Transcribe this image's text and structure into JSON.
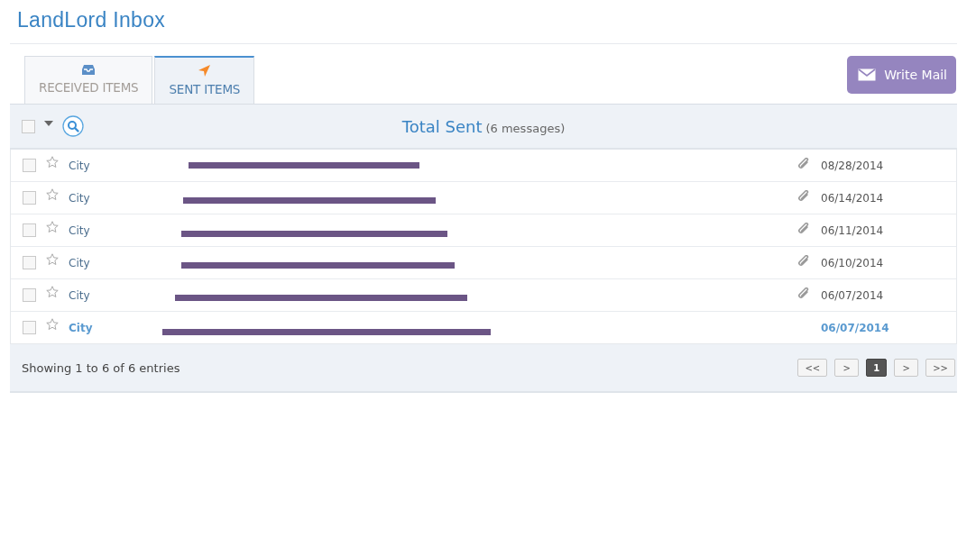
{
  "page": {
    "title": "LandLord Inbox"
  },
  "tabs": [
    {
      "label": "RECEIVED ITEMS",
      "kind": "inbox",
      "selected": false
    },
    {
      "label": "SENT ITEMS",
      "kind": "sent",
      "selected": true
    }
  ],
  "write_button": {
    "label": "Write Mail"
  },
  "toolbar": {
    "select_all": {
      "checked": false
    },
    "heading": "Total Sent",
    "count": "(6 messages)"
  },
  "messages": [
    {
      "sender": "City",
      "subject_redacted": true,
      "attachment": true,
      "date": "08/28/2014",
      "unread": false,
      "checked": false,
      "starred": false
    },
    {
      "sender": "City",
      "subject_redacted": true,
      "attachment": true,
      "date": "06/14/2014",
      "unread": false,
      "checked": false,
      "starred": false
    },
    {
      "sender": "City",
      "subject_redacted": true,
      "attachment": true,
      "date": "06/11/2014",
      "unread": false,
      "checked": false,
      "starred": false
    },
    {
      "sender": "City",
      "subject_redacted": true,
      "attachment": true,
      "date": "06/10/2014",
      "unread": false,
      "checked": false,
      "starred": false
    },
    {
      "sender": "City",
      "subject_redacted": true,
      "attachment": true,
      "date": "06/07/2014",
      "unread": false,
      "checked": false,
      "starred": false
    },
    {
      "sender": "City",
      "subject_redacted": true,
      "attachment": false,
      "date": "06/07/2014",
      "unread": true,
      "checked": false,
      "starred": false
    }
  ],
  "footer": {
    "info": "Showing 1 to 6 of 6 entries",
    "pages": [
      {
        "label": "<<",
        "selected": false
      },
      {
        "label": ">",
        "selected": false
      },
      {
        "label": "1",
        "selected": true
      },
      {
        "label": ">",
        "selected": false
      },
      {
        "label": ">>",
        "selected": false
      }
    ]
  }
}
